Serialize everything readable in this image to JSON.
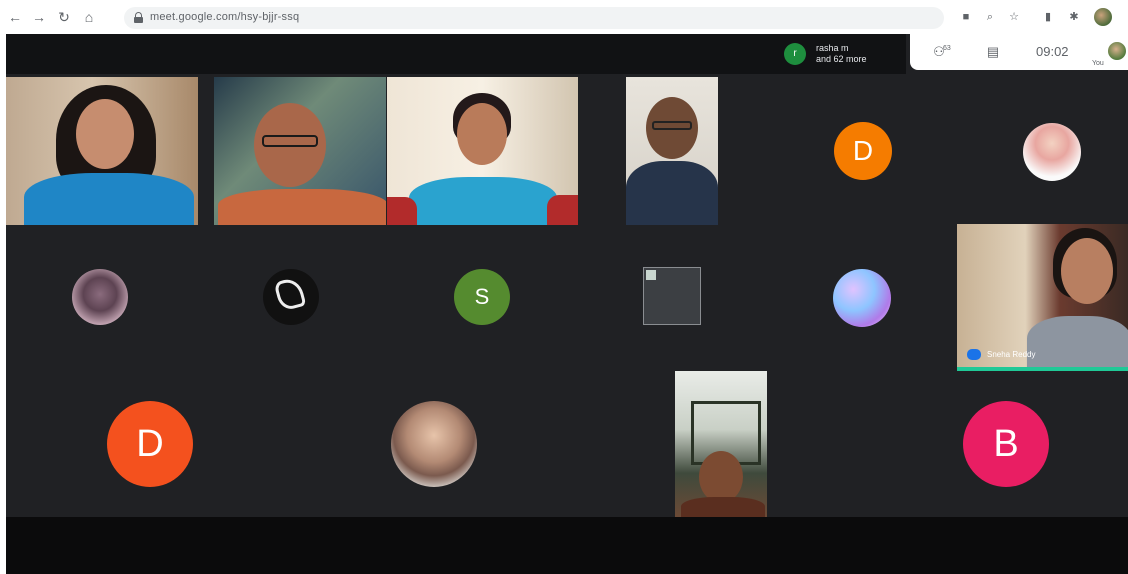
{
  "browser": {
    "url": "meet.google.com/hsy-bjjr-ssq",
    "nav": {
      "back": "←",
      "forward": "→",
      "reload": "↻",
      "home": "⌂"
    },
    "icons": [
      "camera-icon",
      "zoom-icon",
      "star-icon",
      "extension-icon",
      "puzzle-icon",
      "profile-icon"
    ]
  },
  "meet": {
    "joined_notice": {
      "avatar_letter": "r",
      "line1": "rasha m",
      "line2": "and 62 more"
    },
    "toolbar": {
      "people_count": "63",
      "clock": "09:02",
      "you_label": "You"
    },
    "tiles": {
      "avatar_D1": "D",
      "avatar_S": "S",
      "avatar_D2": "D",
      "avatar_B": "B",
      "speaker_name": "Sneha Reddy"
    }
  },
  "colors": {
    "stage_bg": "#202124",
    "orange": "#f57c00",
    "green": "#558b2f",
    "red_orange": "#f4511e",
    "pink": "#e91e63",
    "active_speaker": "#20c997"
  }
}
